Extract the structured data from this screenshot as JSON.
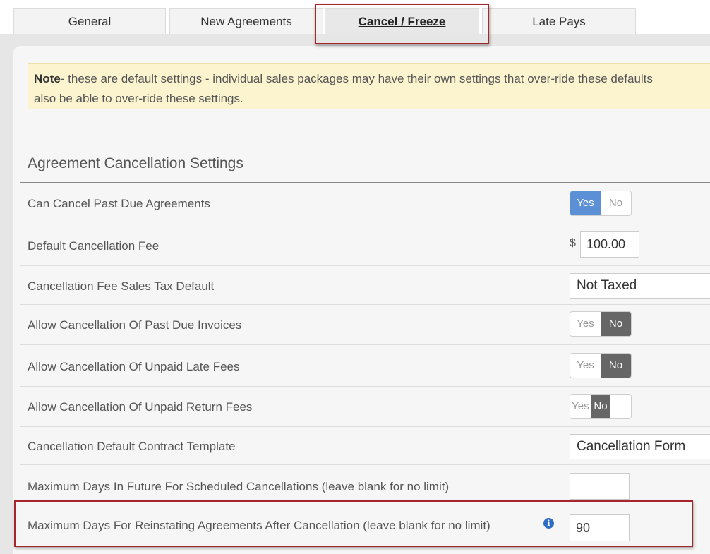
{
  "tabs": [
    {
      "label": "General"
    },
    {
      "label": "New Agreements"
    },
    {
      "label": "Cancel / Freeze"
    },
    {
      "label": "Late Pays"
    }
  ],
  "note": {
    "bold": "Note",
    "line1": "- these are default settings - individual sales packages may have their own settings that over-ride these defaults",
    "line2": "also be able to over-ride these settings."
  },
  "section_title": "Agreement Cancellation Settings",
  "rows": [
    {
      "label": "Can Cancel Past Due Agreements",
      "yes": "Yes",
      "no": "No",
      "selected": "Yes"
    },
    {
      "label": "Default Cancellation Fee",
      "currency": "$",
      "value": "100.00"
    },
    {
      "label": "Cancellation Fee Sales Tax Default",
      "value": "Not Taxed"
    },
    {
      "label": "Allow Cancellation Of Past Due Invoices",
      "yes": "Yes",
      "no": "No",
      "selected": "No"
    },
    {
      "label": "Allow Cancellation Of Unpaid Late Fees",
      "yes": "Yes",
      "no": "No",
      "selected": "No"
    },
    {
      "label": "Allow Cancellation Of Unpaid Return Fees",
      "yes": "Yes",
      "no": "No",
      "selected": "No",
      "locked": true
    },
    {
      "label": "Cancellation Default Contract Template",
      "value": "Cancellation Form"
    },
    {
      "label": "Maximum Days In Future For Scheduled Cancellations (leave blank for no limit)",
      "value": ""
    },
    {
      "label": "Maximum Days For Reinstating Agreements After Cancellation (leave blank for no limit)",
      "value": "90",
      "info_icon": "info-icon"
    }
  ],
  "colors": {
    "highlight": "#a5262c",
    "toggle_yes": "#5b8fd6",
    "toggle_no": "#666666",
    "note_bg": "#fcf4cf"
  }
}
